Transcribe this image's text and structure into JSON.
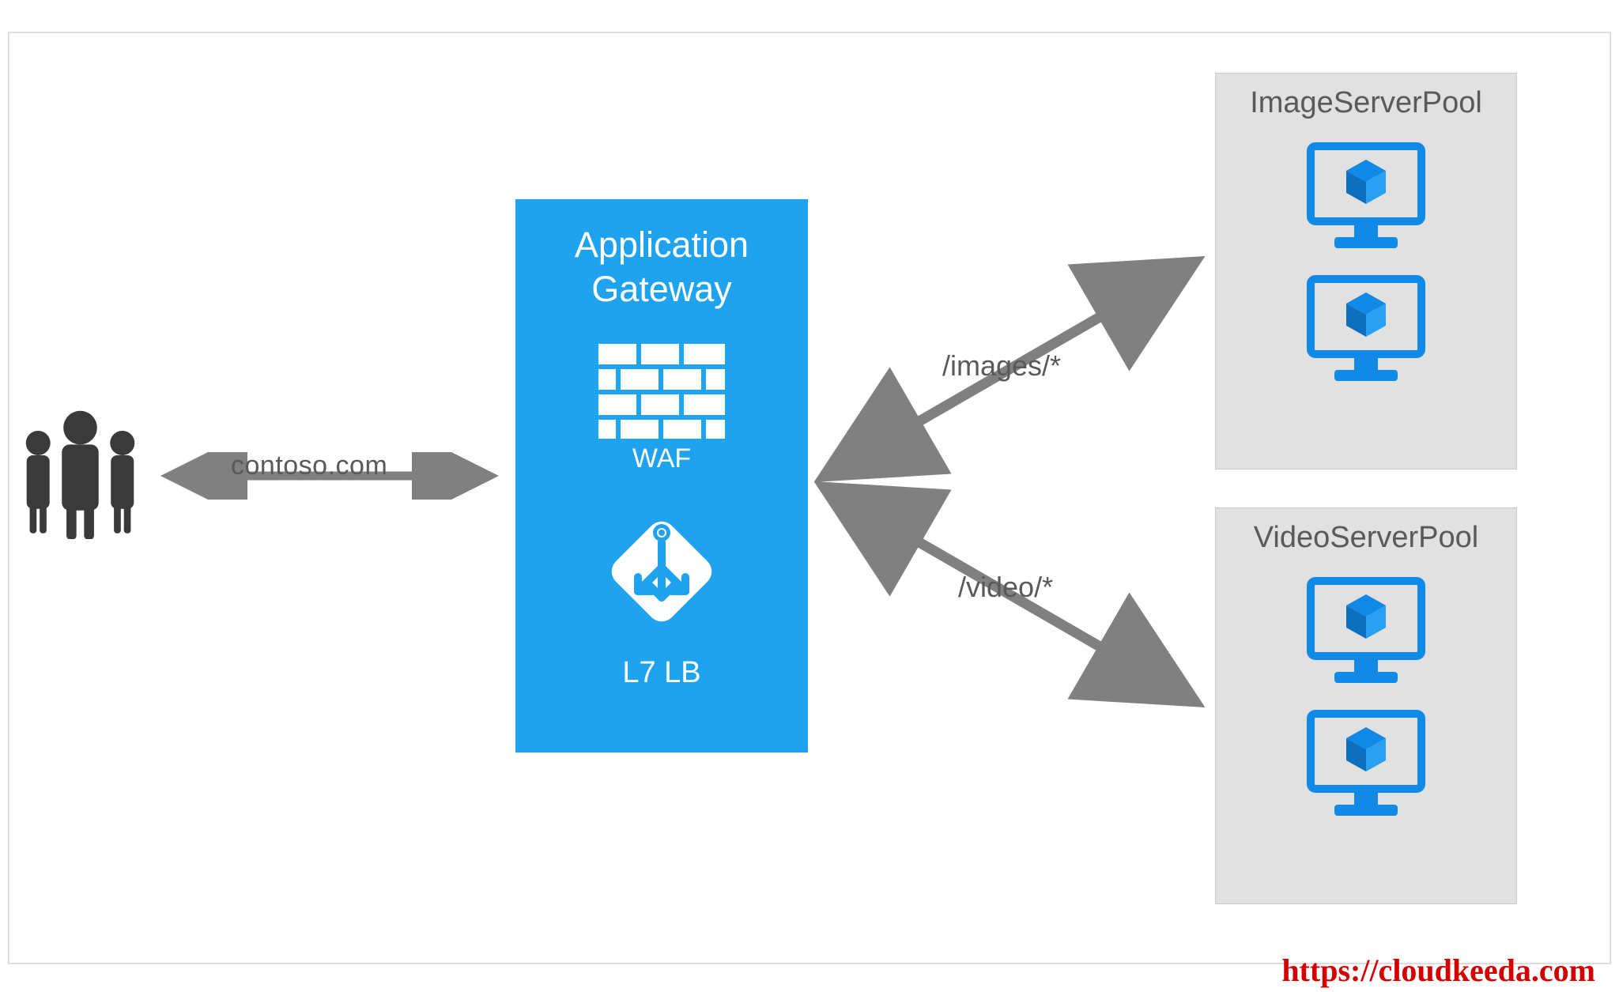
{
  "client_domain": "contoso.com",
  "gateway": {
    "title_line1": "Application",
    "title_line2": "Gateway",
    "waf_label": "WAF",
    "lb_label": "L7 LB"
  },
  "routes": {
    "images": "/images/*",
    "video": "/video/*"
  },
  "pools": {
    "image": "ImageServerPool",
    "video": "VideoServerPool"
  },
  "watermark": "https://cloudkeeda.com",
  "colors": {
    "azure_blue": "#1fa3ee",
    "icon_blue": "#1189e6",
    "grey": "#808080",
    "dark_grey": "#3a3a3a",
    "panel_grey": "#e1e1e1",
    "text_grey": "#595959",
    "red": "#d40000"
  }
}
